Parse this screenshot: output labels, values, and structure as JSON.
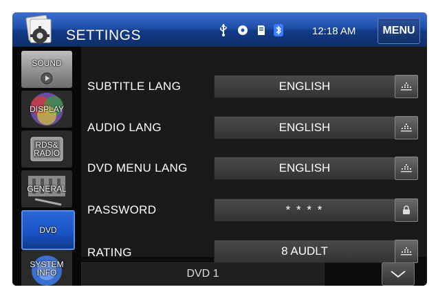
{
  "header": {
    "title": "SETTINGS",
    "time": "12:18 AM",
    "menu_label": "MENU",
    "status_icons": [
      "usb-icon",
      "disc-icon",
      "sd-card-icon",
      "bluetooth-icon"
    ]
  },
  "sidebar": {
    "items": [
      {
        "label": "SOUND",
        "icon": "sound-icon"
      },
      {
        "label": "DISPLAY",
        "icon": "display-icon"
      },
      {
        "label": "RDS& RADIO",
        "icon": "radio-icon"
      },
      {
        "label": "GENERAL",
        "icon": "general-icon"
      },
      {
        "label": "DVD",
        "icon": "dvd-icon",
        "active": true
      },
      {
        "label": "SYSTEM INFO",
        "icon": "system-info-icon"
      }
    ]
  },
  "settings": {
    "rows": [
      {
        "label": "SUBTITLE LANG",
        "value": "ENGLISH",
        "action_icon": "list-icon"
      },
      {
        "label": "AUDIO LANG",
        "value": "ENGLISH",
        "action_icon": "list-icon"
      },
      {
        "label": "DVD MENU LANG",
        "value": "ENGLISH",
        "action_icon": "list-icon"
      },
      {
        "label": "PASSWORD",
        "value": "* * * *",
        "action_icon": "lock-icon"
      },
      {
        "label": "RATING",
        "value": "8 AUDLT",
        "action_icon": "list-icon"
      }
    ]
  },
  "footer": {
    "source": "DVD 1",
    "scroll_icon": "chevron-down-icon"
  },
  "colors": {
    "header_blue": "#1f4fa8",
    "active_item": "#1a56c8",
    "panel_bg": "#1a1a1a"
  }
}
